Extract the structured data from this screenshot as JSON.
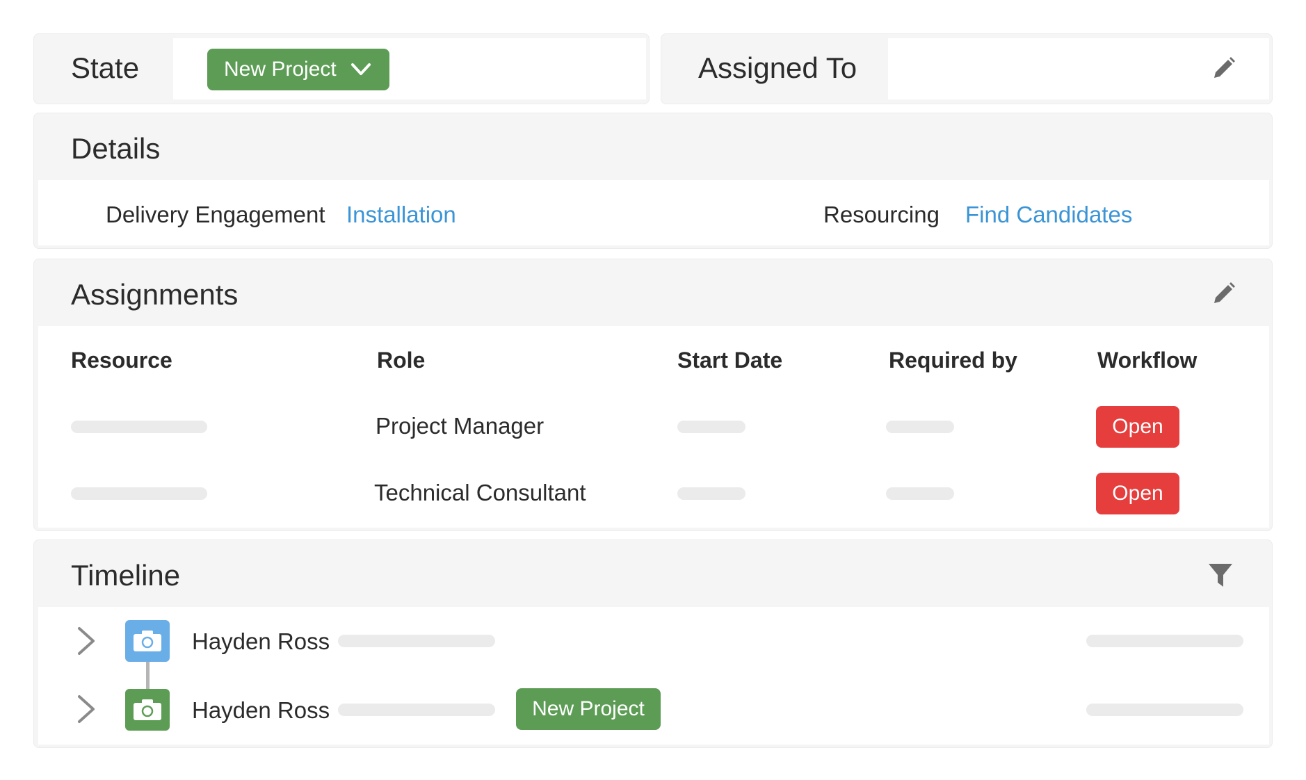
{
  "state_card": {
    "label": "State",
    "value": "New Project",
    "accent": "#5c9c55"
  },
  "assigned_card": {
    "label": "Assigned To",
    "value": ""
  },
  "details": {
    "title": "Details",
    "fields": [
      {
        "label": "Delivery Engagement",
        "value": "Installation"
      },
      {
        "label": "Resourcing",
        "value": "Find Candidates"
      }
    ],
    "link_color": "#3a94d6"
  },
  "assignments": {
    "title": "Assignments",
    "columns": [
      "Resource",
      "Role",
      "Start Date",
      "Required by",
      "Workflow"
    ],
    "rows": [
      {
        "role": "Project Manager",
        "workflow": "Open"
      },
      {
        "role": "Technical Consultant",
        "workflow": "Open"
      }
    ],
    "workflow_color": "#e63d3d"
  },
  "timeline": {
    "title": "Timeline",
    "entries": [
      {
        "name": "Hayden Ross",
        "icon": "camera-icon",
        "icon_color": "#6aaee8",
        "badge": ""
      },
      {
        "name": "Hayden Ross",
        "icon": "camera-icon",
        "icon_color": "#5c9c55",
        "badge": "New Project"
      }
    ]
  },
  "icons": {
    "edit": "pencil-icon",
    "filter": "filter-icon",
    "dropdown": "chevron-down-icon",
    "expand": "chevron-right-icon"
  }
}
